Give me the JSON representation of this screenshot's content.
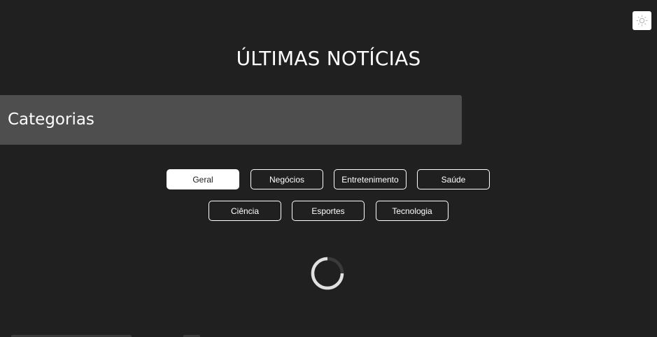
{
  "header": {
    "theme_toggle_icon": "sun-icon",
    "title": "ÚLTIMAS NOTÍCIAS"
  },
  "categories": {
    "heading": "Categorias",
    "items": [
      {
        "label": "Geral",
        "active": true
      },
      {
        "label": "Negócios",
        "active": false
      },
      {
        "label": "Entretenimento",
        "active": false
      },
      {
        "label": "Saúde",
        "active": false
      },
      {
        "label": "Ciência",
        "active": false
      },
      {
        "label": "Esportes",
        "active": false
      },
      {
        "label": "Tecnologia",
        "active": false
      }
    ]
  },
  "loading": {
    "icon": "spinner-icon"
  },
  "colors": {
    "background": "#202020",
    "banner": "#4e4e4e",
    "text": "#ffffff"
  }
}
